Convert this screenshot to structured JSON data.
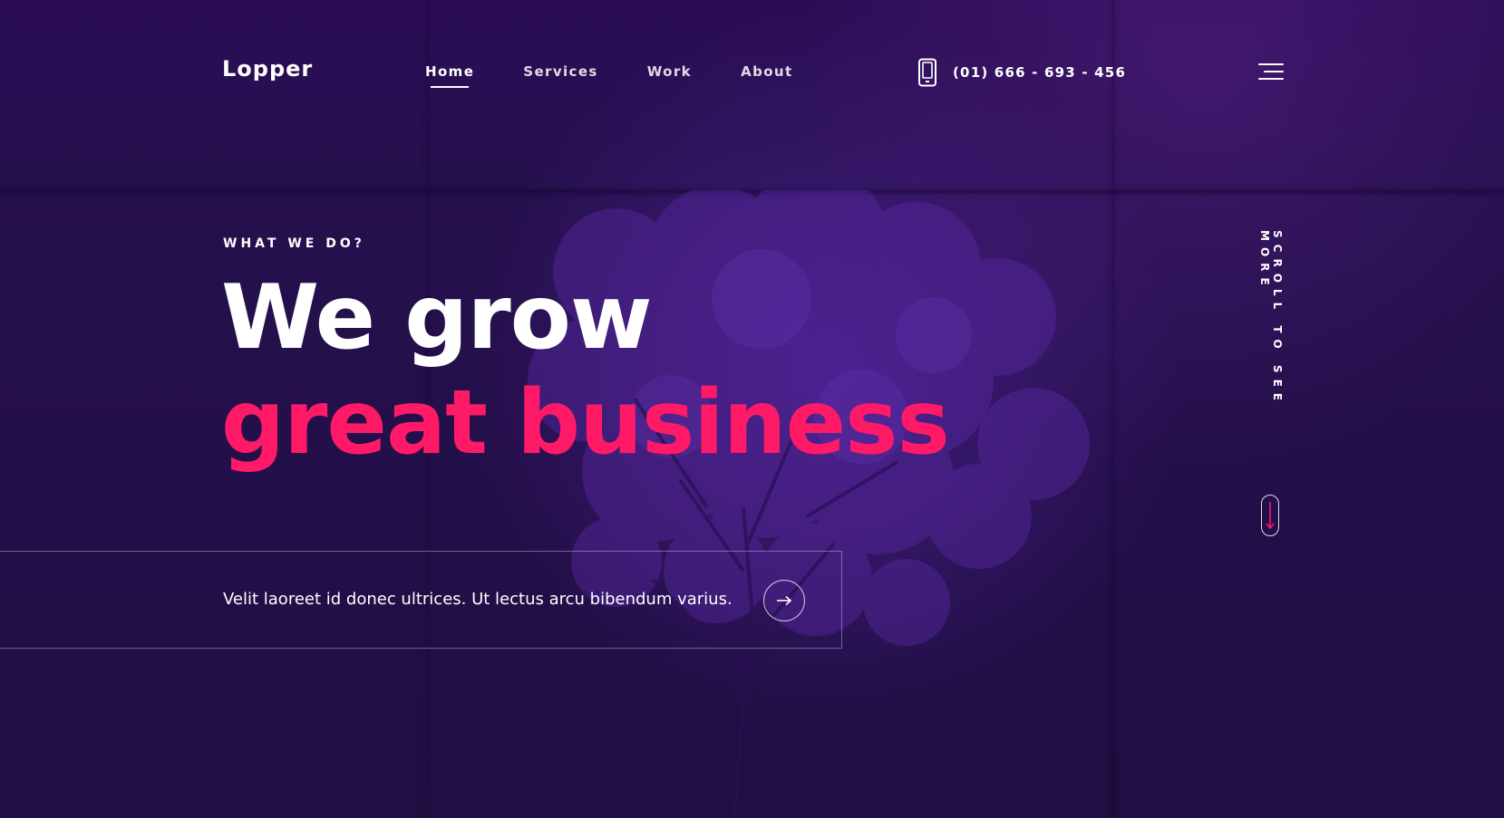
{
  "header": {
    "logo": "Lopper",
    "nav": [
      {
        "label": "Home",
        "active": true
      },
      {
        "label": "Services",
        "active": false
      },
      {
        "label": "Work",
        "active": false
      },
      {
        "label": "About",
        "active": false
      }
    ],
    "phone": "(01) 666 - 693 - 456",
    "phone_icon": "phone-icon",
    "menu_icon": "hamburger-menu-icon"
  },
  "hero": {
    "eyebrow": "WHAT WE DO?",
    "headline_line_1": "We grow",
    "headline_line_2": "great business",
    "description": "Velit laoreet id donec ultrices. Ut lectus arcu bibendum varius.",
    "cta_icon": "arrow-right-icon"
  },
  "scroll": {
    "label": "SCROLL TO SEE MORE",
    "icon": "scroll-down-arrow-icon"
  },
  "colors": {
    "background": "#23104a",
    "accent": "#ff1a67",
    "text": "#ffffff"
  }
}
